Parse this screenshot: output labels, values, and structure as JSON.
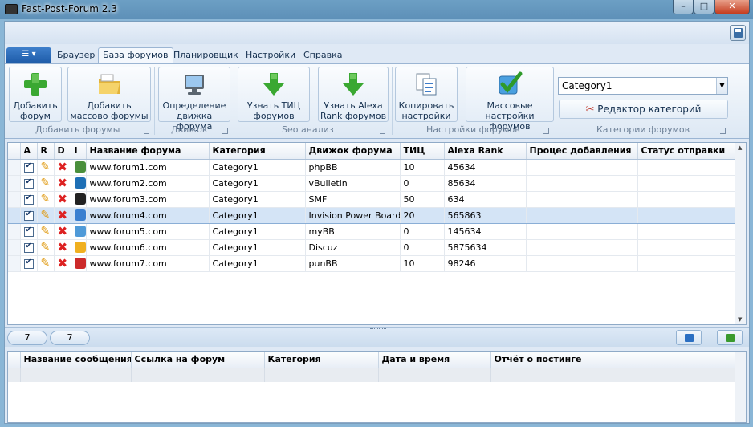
{
  "window": {
    "title": "Fast-Post-Forum 2.3",
    "controls": {
      "minimize": "–",
      "maximize": "□",
      "close": "✕"
    }
  },
  "app_menu": {
    "icon": "menu-icon",
    "arrow": "▾"
  },
  "tabs": [
    {
      "label": "Браузер",
      "active": false
    },
    {
      "label": "База форумов",
      "active": true
    },
    {
      "label": "Планировщик",
      "active": false
    },
    {
      "label": "Настройки",
      "active": false
    },
    {
      "label": "Справка",
      "active": false
    }
  ],
  "ribbon": {
    "buttons": {
      "add_forum": "Добавить форум",
      "add_bulk": "Добавить массово форумы",
      "detect_engine": "Определение движка форума",
      "tic": "Узнать ТИЦ форумов",
      "alexa": "Узнать Alexa Rank форумов",
      "copy_settings": "Копировать настройки",
      "bulk_settings": "Массовые настройки форумов"
    },
    "groups": {
      "add": "Добавить форумы",
      "engine": "Движок",
      "seo": "Seo анализ",
      "forum_settings": "Настройки форумов",
      "categories": "Категории форумов"
    },
    "category_select": {
      "value": "Category1"
    },
    "category_editor": "Редактор категорий"
  },
  "forum_table": {
    "columns": [
      "A",
      "R",
      "D",
      "I",
      "Название форума",
      "Категория",
      "Движок форума",
      "ТИЦ",
      "Alexa Rank",
      "Процес добавления",
      "Статус отправки"
    ],
    "rows": [
      {
        "name": "www.forum1.com",
        "category": "Category1",
        "engine": "phpBB",
        "tic": "10",
        "alexa": "45634",
        "process": "",
        "status": "",
        "engine_icon_color": "#4a8f3c",
        "selected": false
      },
      {
        "name": "www.forum2.com",
        "category": "Category1",
        "engine": "vBulletin",
        "tic": "0",
        "alexa": "85634",
        "process": "",
        "status": "",
        "engine_icon_color": "#1e6fb5",
        "selected": false
      },
      {
        "name": "www.forum3.com",
        "category": "Category1",
        "engine": "SMF",
        "tic": "50",
        "alexa": "634",
        "process": "",
        "status": "",
        "engine_icon_color": "#222222",
        "selected": false
      },
      {
        "name": "www.forum4.com",
        "category": "Category1",
        "engine": "Invision Power Board",
        "tic": "20",
        "alexa": "565863",
        "process": "",
        "status": "",
        "engine_icon_color": "#3a7fd0",
        "selected": true
      },
      {
        "name": "www.forum5.com",
        "category": "Category1",
        "engine": "myBB",
        "tic": "0",
        "alexa": "145634",
        "process": "",
        "status": "",
        "engine_icon_color": "#4f9ad8",
        "selected": false
      },
      {
        "name": "www.forum6.com",
        "category": "Category1",
        "engine": "Discuz",
        "tic": "0",
        "alexa": "5875634",
        "process": "",
        "status": "",
        "engine_icon_color": "#f0b020",
        "selected": false
      },
      {
        "name": "www.forum7.com",
        "category": "Category1",
        "engine": "punBB",
        "tic": "10",
        "alexa": "98246",
        "process": "",
        "status": "",
        "engine_icon_color": "#cc2a2a",
        "selected": false
      }
    ]
  },
  "counters": [
    "7",
    "7"
  ],
  "nav": {
    "prev_color": "#2b6fc2",
    "next_color": "#3a9a2e"
  },
  "message_table": {
    "columns": [
      "Название сообщения",
      "Ссылка на форум",
      "Категория",
      "Дата и время",
      "Отчёт о постинге"
    ]
  },
  "colors": {
    "accent": "#1d5ba8",
    "selection": "#d4e4f6",
    "delete": "#dd2222",
    "edit": "#e09a10"
  }
}
